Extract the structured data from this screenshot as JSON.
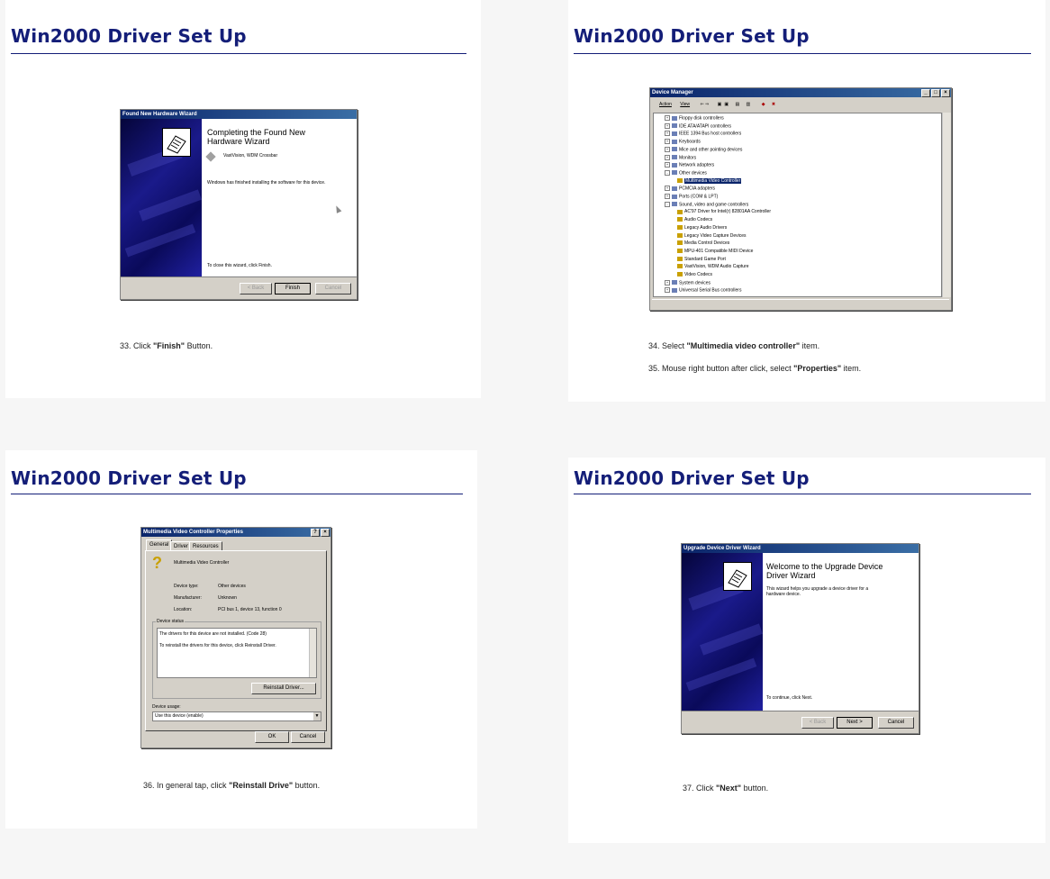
{
  "panels": [
    {
      "title": "Win2000 Driver Set Up",
      "caption": {
        "prefix": "33. Click ",
        "bold": "\"Finish\"",
        "suffix": " Button."
      },
      "dialog": {
        "window_title": "Found New Hardware Wizard",
        "heading_line1": "Completing the Found New",
        "heading_line2": "Hardware Wizard",
        "device_name": "VastVision, WDM Crossbar",
        "message": "Windows has finished installing the software for this device.",
        "footer_text": "To close this wizard, click Finish.",
        "buttons": {
          "back": "< Back",
          "finish": "Finish",
          "cancel": "Cancel"
        }
      }
    },
    {
      "title": "Win2000 Driver Set Up",
      "caption1": {
        "prefix": "34. Select ",
        "bold": "\"Multimedia video controller\"",
        "suffix": " item."
      },
      "caption2": {
        "prefix": "35. Mouse right button after click, select ",
        "bold": "\"Properties\"",
        "suffix": " item."
      },
      "dialog": {
        "window_title": "Device Manager",
        "menu": {
          "action": "Action",
          "view": "View"
        },
        "tree": [
          {
            "label": "Floppy disk controllers",
            "level": 0,
            "exp": "+"
          },
          {
            "label": "IDE ATA/ATAPI controllers",
            "level": 0,
            "exp": "+"
          },
          {
            "label": "IEEE 1394 Bus host controllers",
            "level": 0,
            "exp": "+"
          },
          {
            "label": "Keyboards",
            "level": 0,
            "exp": "+"
          },
          {
            "label": "Mice and other pointing devices",
            "level": 0,
            "exp": "+"
          },
          {
            "label": "Monitors",
            "level": 0,
            "exp": "+"
          },
          {
            "label": "Network adapters",
            "level": 0,
            "exp": "+"
          },
          {
            "label": "Other devices",
            "level": 0,
            "exp": "-"
          },
          {
            "label": "Multimedia Video Controller",
            "level": 1,
            "selected": true
          },
          {
            "label": "PCMCIA adapters",
            "level": 0,
            "exp": "+"
          },
          {
            "label": "Ports (COM & LPT)",
            "level": 0,
            "exp": "+"
          },
          {
            "label": "Sound, video and game controllers",
            "level": 0,
            "exp": "-"
          },
          {
            "label": "AC'97 Driver for Intel(r) 82801AA Controller",
            "level": 1
          },
          {
            "label": "Audio Codecs",
            "level": 1
          },
          {
            "label": "Legacy Audio Drivers",
            "level": 1
          },
          {
            "label": "Legacy Video Capture Devices",
            "level": 1
          },
          {
            "label": "Media Control Devices",
            "level": 1
          },
          {
            "label": "MPU-401 Compatible MIDI Device",
            "level": 1
          },
          {
            "label": "Standard Game Port",
            "level": 1
          },
          {
            "label": "VastVision, WDM Audio Capture",
            "level": 1
          },
          {
            "label": "Video Codecs",
            "level": 1
          },
          {
            "label": "System devices",
            "level": 0,
            "exp": "+"
          },
          {
            "label": "Universal Serial Bus controllers",
            "level": 0,
            "exp": "+"
          }
        ]
      }
    },
    {
      "title": "Win2000 Driver Set Up",
      "caption": {
        "prefix": "36. In general tap, click ",
        "bold": "\"Reinstall Drive\"",
        "suffix": " button."
      },
      "dialog": {
        "window_title": "Multimedia Video Controller Properties",
        "tabs": [
          "General",
          "Driver",
          "Resources"
        ],
        "device_name": "Multimedia Video Controller",
        "device_type_label": "Device type:",
        "device_type_value": "Other devices",
        "manufacturer_label": "Manufacturer:",
        "manufacturer_value": "Unknown",
        "location_label": "Location:",
        "location_value": "PCI bus 1, device 13, function 0",
        "status_group_label": "Device status",
        "status_line1": "The drivers for this device are not installed. (Code 28)",
        "status_line2": "To reinstall the drivers for this device, click Reinstall Driver.",
        "reinstall_button": "Reinstall Driver...",
        "usage_label": "Device usage:",
        "usage_value": "Use this device (enable)",
        "buttons": {
          "ok": "OK",
          "cancel": "Cancel"
        }
      }
    },
    {
      "title": "Win2000 Driver Set Up",
      "caption": {
        "prefix": "37. Click ",
        "bold": "\"Next\"",
        "suffix": " button."
      },
      "dialog": {
        "window_title": "Upgrade Device Driver Wizard",
        "heading_line1": "Welcome to the Upgrade Device",
        "heading_line2": "Driver Wizard",
        "message_line1": "This wizard helps you upgrade a device driver for a",
        "message_line2": "hardware device.",
        "footer_text": "To continue, click Next.",
        "buttons": {
          "back": "< Back",
          "next": "Next >",
          "cancel": "Cancel"
        }
      }
    }
  ]
}
